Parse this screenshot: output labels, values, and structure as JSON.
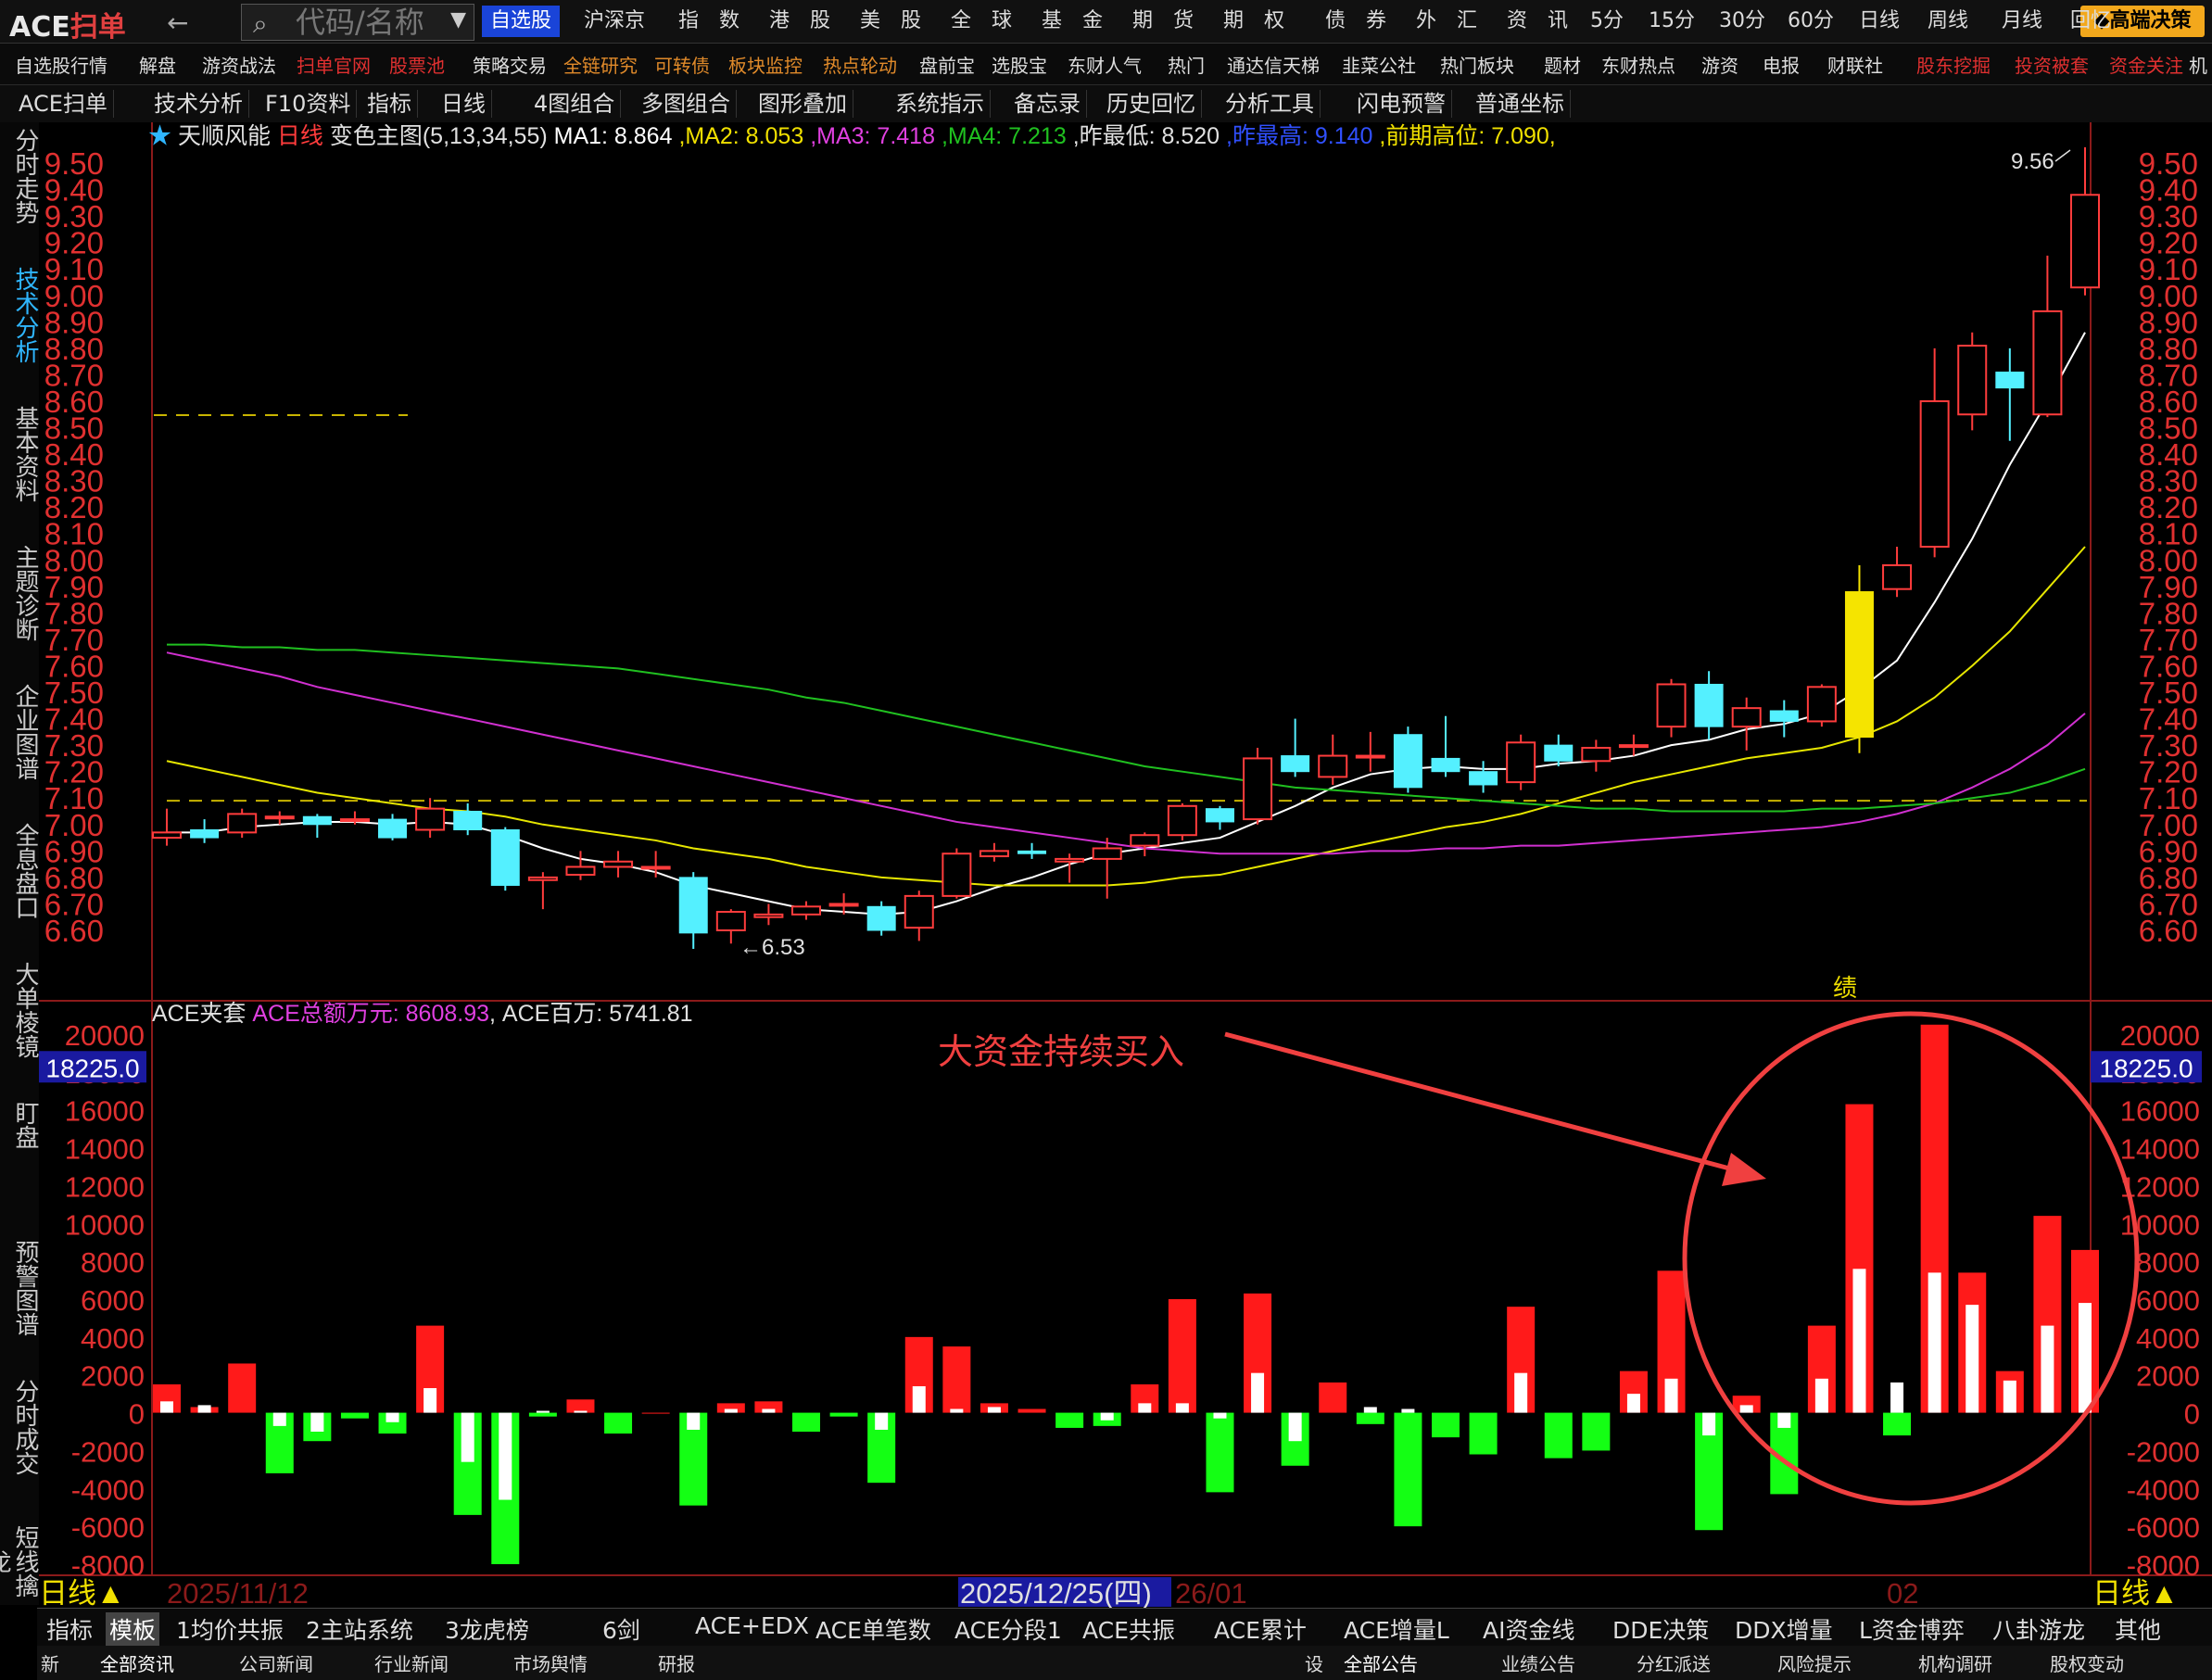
{
  "topbar": {
    "logo_a": "ACE",
    "logo_b": "扫单",
    "back_icon": "arrow-left-icon",
    "search_placeholder": "代码/名称",
    "buttons": [
      "自选股",
      "沪深京",
      "指　数",
      "港　股",
      "美　股",
      "全　球",
      "基　金",
      "期　货",
      "期　权",
      "债　券",
      "外　汇",
      "资　讯",
      "5分",
      "15分",
      "30分",
      "60分",
      "日线",
      "周线",
      "月线",
      "回忆"
    ],
    "gaoduan": "高端决策",
    "accent_blue": "#1a44d8",
    "accent_gold": "#f3a81c"
  },
  "bar2": {
    "items": [
      "自选股行情",
      "解盘",
      "游资战法",
      "扫单官网",
      "股票池",
      "策略交易",
      "全链研究",
      "可转债",
      "板块监控",
      "热点轮动",
      "盘前宝",
      "选股宝",
      "东财人气",
      "热门",
      "通达信天梯",
      "韭菜公社",
      "热门板块",
      "题材",
      "东财热点",
      "游资",
      "电报",
      "财联社",
      "股东挖掘",
      "投资被套",
      "资金关注",
      "机"
    ]
  },
  "bar3": {
    "items": [
      "ACE扫单",
      "技术分析",
      "F10资料",
      "指标",
      "日线",
      "4图组合",
      "多图组合",
      "图形叠加",
      "系统指示",
      "备忘录",
      "历史回忆",
      "分析工具",
      "闪电预警",
      "普通坐标"
    ]
  },
  "sidebar": {
    "items": [
      "分时走势",
      "技术分析",
      "基本资料",
      "主题诊断",
      "企业图谱",
      "全息盘口",
      "大单棱镜",
      "盯盘",
      "预警图谱",
      "分时成交",
      "短线擒龙"
    ]
  },
  "main_header": {
    "star": "★",
    "stock": "天顺风能",
    "period": "日线",
    "indicator": "变色主图(5,13,34,55)",
    "ma1": "MA1: 8.864",
    "ma2": "MA2: 8.053",
    "ma3": "MA3: 7.418",
    "ma4": "MA4: 7.213",
    "prev_low": "昨最低: 8.520",
    "prev_high": "昨最高: 9.140",
    "prior_high": "前期高位: 7.090",
    "colors": {
      "ma1": "#ffffff",
      "ma2": "#f0e000",
      "ma3": "#e040e0",
      "ma4": "#20c020",
      "prev_high": "#3050ff",
      "prior_high": "#f0e000"
    }
  },
  "sub_header": {
    "name": "ACE夹套",
    "total": "ACE总额万元: 8608.93",
    "million": "ACE百万: 5741.81",
    "level_tag": "18225.0"
  },
  "annotation": {
    "text": "大资金持续买入",
    "marker": "绩",
    "color": "#f04040"
  },
  "dates": {
    "d1": "2025/11/12",
    "d2": "2025/12/25(四)",
    "d3": "26/01",
    "d4": "02",
    "period_left": "日线▲",
    "period_right": "日线▲"
  },
  "bottom_tabs": [
    "指标",
    "模板",
    "1均价共振",
    "2主站系统",
    "3龙虎榜",
    "6剑",
    "ACE+EDX",
    "ACE单笔数",
    "ACE分段1",
    "ACE共振",
    "ACE累计",
    "ACE增量L",
    "AI资金线",
    "DDE决策",
    "DDX增量",
    "L资金博弈",
    "八卦游龙",
    "其他"
  ],
  "news_tabs": [
    "新",
    "全部资讯",
    "公司新闻",
    "行业新闻",
    "市场舆情",
    "研报",
    "设",
    "全部公告",
    "业绩公告",
    "分红派送",
    "风险提示",
    "机构调研",
    "股权变动"
  ],
  "chart_data": {
    "type": "candlestick",
    "price_axis": {
      "min": 6.6,
      "max": 9.5,
      "ticks": [
        "9.50",
        "9.40",
        "9.30",
        "9.20",
        "9.10",
        "9.00",
        "8.90",
        "8.80",
        "8.70",
        "8.60",
        "8.50",
        "8.40",
        "8.30",
        "8.20",
        "8.10",
        "8.00",
        "7.90",
        "7.80",
        "7.70",
        "7.60",
        "7.50",
        "7.40",
        "7.30",
        "7.20",
        "7.10",
        "7.00",
        "6.90",
        "6.80",
        "6.70",
        "6.60"
      ]
    },
    "labels": {
      "high": "9.56",
      "low": "6.53"
    },
    "prior_high_level": 7.09,
    "candles": [
      [
        6.95,
        6.97,
        7.06,
        6.92
      ],
      [
        6.98,
        6.95,
        7.02,
        6.93
      ],
      [
        6.97,
        7.04,
        7.06,
        6.95
      ],
      [
        7.03,
        7.03,
        7.05,
        7.0
      ],
      [
        7.03,
        7.0,
        7.04,
        6.95
      ],
      [
        7.02,
        7.02,
        7.05,
        7.0
      ],
      [
        7.02,
        6.95,
        7.04,
        6.94
      ],
      [
        6.98,
        7.06,
        7.1,
        6.95
      ],
      [
        7.05,
        6.98,
        7.08,
        6.96
      ],
      [
        6.98,
        6.77,
        6.99,
        6.75
      ],
      [
        6.79,
        6.8,
        6.82,
        6.68
      ],
      [
        6.81,
        6.84,
        6.9,
        6.79
      ],
      [
        6.84,
        6.86,
        6.9,
        6.8
      ],
      [
        6.84,
        6.84,
        6.9,
        6.8
      ],
      [
        6.8,
        6.59,
        6.82,
        6.53
      ],
      [
        6.6,
        6.67,
        6.68,
        6.55
      ],
      [
        6.65,
        6.66,
        6.7,
        6.62
      ],
      [
        6.66,
        6.69,
        6.71,
        6.64
      ],
      [
        6.7,
        6.7,
        6.74,
        6.66
      ],
      [
        6.69,
        6.6,
        6.71,
        6.58
      ],
      [
        6.61,
        6.73,
        6.75,
        6.56
      ],
      [
        6.73,
        6.89,
        6.91,
        6.72
      ],
      [
        6.88,
        6.9,
        6.93,
        6.86
      ],
      [
        6.9,
        6.89,
        6.93,
        6.87
      ],
      [
        6.86,
        6.87,
        6.89,
        6.78
      ],
      [
        6.87,
        6.91,
        6.95,
        6.72
      ],
      [
        6.92,
        6.96,
        6.97,
        6.88
      ],
      [
        6.96,
        7.07,
        7.08,
        6.94
      ],
      [
        7.06,
        7.01,
        7.07,
        6.98
      ],
      [
        7.02,
        7.25,
        7.29,
        7.0
      ],
      [
        7.26,
        7.2,
        7.4,
        7.18
      ],
      [
        7.18,
        7.26,
        7.34,
        7.15
      ],
      [
        7.26,
        7.26,
        7.35,
        7.2
      ],
      [
        7.34,
        7.14,
        7.37,
        7.12
      ],
      [
        7.25,
        7.2,
        7.41,
        7.18
      ],
      [
        7.2,
        7.15,
        7.24,
        7.12
      ],
      [
        7.16,
        7.31,
        7.34,
        7.13
      ],
      [
        7.3,
        7.24,
        7.34,
        7.22
      ],
      [
        7.24,
        7.29,
        7.32,
        7.2
      ],
      [
        7.3,
        7.3,
        7.34,
        7.26
      ],
      [
        7.37,
        7.53,
        7.55,
        7.33
      ],
      [
        7.53,
        7.37,
        7.58,
        7.32
      ],
      [
        7.37,
        7.44,
        7.48,
        7.28
      ],
      [
        7.43,
        7.39,
        7.47,
        7.33
      ],
      [
        7.39,
        7.52,
        7.53,
        7.37
      ],
      [
        7.33,
        7.88,
        7.98,
        7.27
      ],
      [
        7.89,
        7.98,
        8.05,
        7.86
      ],
      [
        8.05,
        8.6,
        8.8,
        8.01
      ],
      [
        8.55,
        8.81,
        8.86,
        8.49
      ],
      [
        8.71,
        8.65,
        8.8,
        8.45
      ],
      [
        8.55,
        8.94,
        9.15,
        8.54
      ],
      [
        9.03,
        9.38,
        9.56,
        9.0
      ]
    ],
    "ma_series": {
      "ma1": [
        6.97,
        6.97,
        6.99,
        7.0,
        7.01,
        7.01,
        7.0,
        7.01,
        7.0,
        6.96,
        6.91,
        6.87,
        6.85,
        6.82,
        6.77,
        6.74,
        6.71,
        6.68,
        6.67,
        6.66,
        6.67,
        6.71,
        6.76,
        6.8,
        6.85,
        6.89,
        6.91,
        6.93,
        6.95,
        7.01,
        7.07,
        7.14,
        7.19,
        7.21,
        7.22,
        7.21,
        7.21,
        7.23,
        7.24,
        7.26,
        7.3,
        7.32,
        7.36,
        7.38,
        7.42,
        7.51,
        7.62,
        7.84,
        8.08,
        8.36,
        8.6,
        8.86
      ],
      "ma2": [
        7.24,
        7.21,
        7.18,
        7.15,
        7.12,
        7.1,
        7.08,
        7.06,
        7.05,
        7.03,
        7.0,
        6.98,
        6.96,
        6.94,
        6.91,
        6.89,
        6.87,
        6.84,
        6.82,
        6.8,
        6.79,
        6.78,
        6.77,
        6.77,
        6.77,
        6.77,
        6.78,
        6.8,
        6.81,
        6.84,
        6.87,
        6.9,
        6.93,
        6.96,
        6.99,
        7.01,
        7.04,
        7.08,
        7.12,
        7.16,
        7.19,
        7.22,
        7.25,
        7.27,
        7.29,
        7.33,
        7.39,
        7.48,
        7.6,
        7.73,
        7.89,
        8.05
      ],
      "ma3": [
        7.65,
        7.62,
        7.59,
        7.56,
        7.52,
        7.49,
        7.46,
        7.43,
        7.4,
        7.37,
        7.34,
        7.31,
        7.28,
        7.25,
        7.22,
        7.19,
        7.16,
        7.13,
        7.1,
        7.07,
        7.04,
        7.01,
        6.99,
        6.97,
        6.95,
        6.93,
        6.91,
        6.9,
        6.89,
        6.89,
        6.89,
        6.89,
        6.9,
        6.9,
        6.91,
        6.91,
        6.92,
        6.92,
        6.93,
        6.94,
        6.95,
        6.96,
        6.97,
        6.98,
        6.99,
        7.01,
        7.04,
        7.08,
        7.14,
        7.21,
        7.3,
        7.42
      ],
      "ma4": [
        7.68,
        7.68,
        7.67,
        7.67,
        7.66,
        7.66,
        7.65,
        7.64,
        7.63,
        7.62,
        7.61,
        7.6,
        7.59,
        7.57,
        7.55,
        7.53,
        7.51,
        7.48,
        7.46,
        7.43,
        7.4,
        7.37,
        7.34,
        7.31,
        7.28,
        7.25,
        7.22,
        7.2,
        7.18,
        7.16,
        7.14,
        7.13,
        7.12,
        7.11,
        7.1,
        7.09,
        7.08,
        7.07,
        7.06,
        7.06,
        7.05,
        7.05,
        7.05,
        7.05,
        7.06,
        7.06,
        7.07,
        7.08,
        7.1,
        7.12,
        7.16,
        7.21
      ]
    },
    "flow_axis": {
      "min": -8000,
      "max": 20000,
      "ticks": [
        "20000",
        "18000",
        "16000",
        "14000",
        "12000",
        "10000",
        "8000",
        "6000",
        "4000",
        "2000",
        "0",
        "-2000",
        "-4000",
        "-6000",
        "-8000"
      ]
    },
    "flow_total": [
      1500,
      300,
      2600,
      -3200,
      -1500,
      -300,
      -1100,
      4600,
      -5400,
      -8000,
      -200,
      700,
      -1100,
      0,
      -4900,
      500,
      600,
      -1000,
      -200,
      -3700,
      4000,
      3500,
      500,
      200,
      -800,
      -700,
      1500,
      6000,
      -4200,
      6300,
      -2800,
      1600,
      -600,
      -6000,
      -1300,
      -2200,
      5600,
      -2400,
      -2000,
      2200,
      7500,
      -6200,
      900,
      -4300,
      4600,
      16300,
      -1200,
      20500,
      7400,
      2200,
      10400,
      8600
    ],
    "flow_large": [
      600,
      400,
      0,
      -700,
      -1000,
      0,
      -500,
      1300,
      -2600,
      -4600,
      100,
      100,
      0,
      0,
      -900,
      200,
      200,
      0,
      0,
      -900,
      1400,
      200,
      300,
      0,
      0,
      -400,
      500,
      500,
      -300,
      2100,
      -1500,
      0,
      300,
      200,
      0,
      0,
      2100,
      0,
      0,
      1000,
      1800,
      -1200,
      400,
      -800,
      1800,
      7600,
      1600,
      7400,
      5700,
      1700,
      4600,
      5800
    ]
  }
}
